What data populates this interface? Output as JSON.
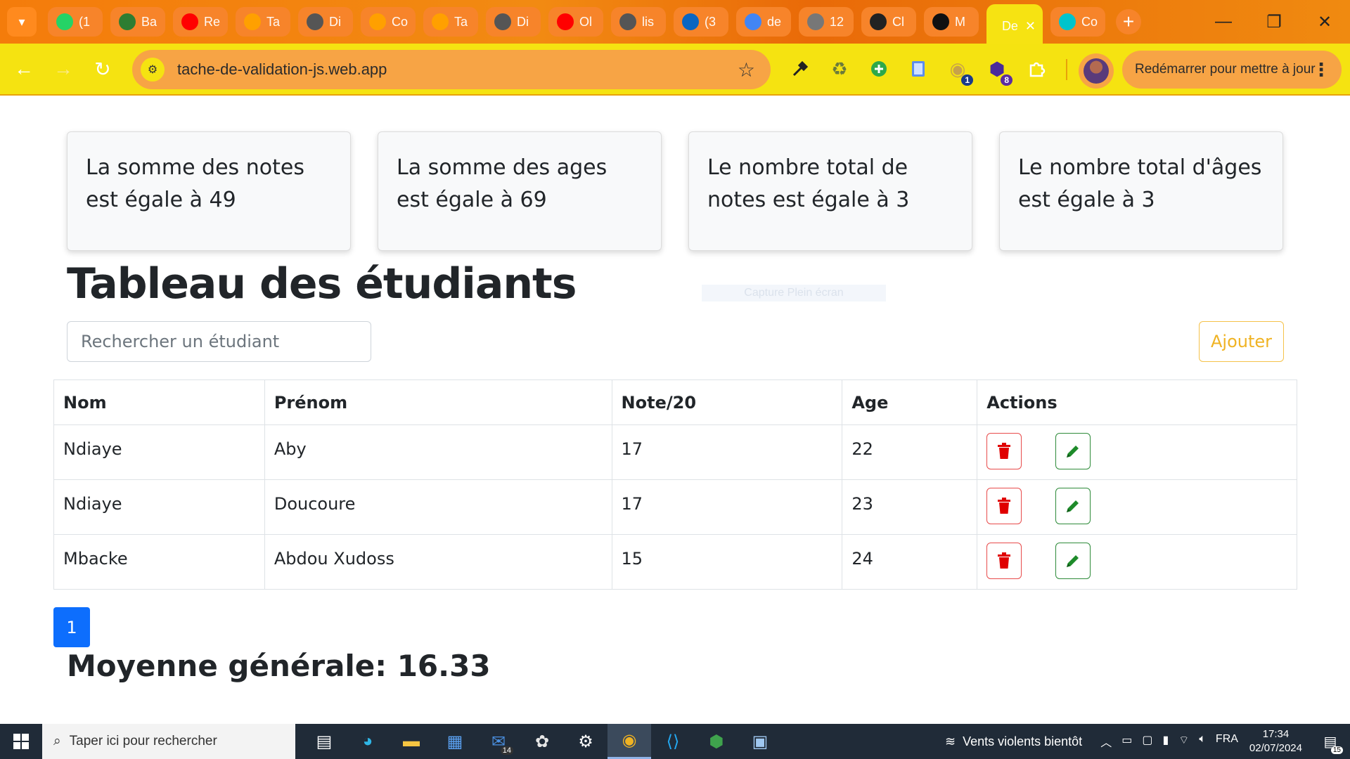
{
  "browser": {
    "tabs": [
      {
        "title": "(1",
        "icon": "whatsapp-icon",
        "color": "#25d366"
      },
      {
        "title": "Ba",
        "icon": "app-icon",
        "color": "#2e7d32"
      },
      {
        "title": "Re",
        "icon": "youtube-icon",
        "color": "#ff0000"
      },
      {
        "title": "Ta",
        "icon": "firebase-icon",
        "color": "#ffa000"
      },
      {
        "title": "Di",
        "icon": "globe-icon",
        "color": "#555555"
      },
      {
        "title": "Co",
        "icon": "firebase-icon",
        "color": "#ffa000"
      },
      {
        "title": "Ta",
        "icon": "firebase-icon",
        "color": "#ffa000"
      },
      {
        "title": "Di",
        "icon": "globe-icon",
        "color": "#555555"
      },
      {
        "title": "Ol",
        "icon": "youtube-icon",
        "color": "#ff0000"
      },
      {
        "title": "lis",
        "icon": "globe-icon",
        "color": "#555555"
      },
      {
        "title": "(3",
        "icon": "linkedin-icon",
        "color": "#0a66c2"
      },
      {
        "title": "de",
        "icon": "docs-icon",
        "color": "#4285f4"
      },
      {
        "title": "12",
        "icon": "globe-icon",
        "color": "#777777"
      },
      {
        "title": "Cl",
        "icon": "chatgpt-icon",
        "color": "#222222"
      },
      {
        "title": "M",
        "icon": "github-icon",
        "color": "#111111"
      },
      {
        "title": "De",
        "icon": "page-icon",
        "color": "#ffffff",
        "active": true
      },
      {
        "title": "Co",
        "icon": "canva-icon",
        "color": "#00c4cc"
      }
    ],
    "url": "tache-de-validation-js.web.app",
    "update_label": "Redémarrer pour mettre à jour",
    "extension_badges": {
      "first": "1",
      "second": "8"
    }
  },
  "page": {
    "cards": [
      "La somme des notes est égale à 49",
      "La somme des ages est égale à 69",
      "Le nombre total de notes est égale à 3",
      "Le nombre total d'âges est égale à 3"
    ],
    "title": "Tableau des étudiants",
    "capture_overlay": "Capture Plein écran",
    "search_placeholder": "Rechercher un étudiant",
    "add_label": "Ajouter",
    "table": {
      "headers": [
        "Nom",
        "Prénom",
        "Note/20",
        "Age",
        "Actions"
      ],
      "rows": [
        {
          "nom": "Ndiaye",
          "prenom": "Aby",
          "note": "17",
          "age": "22"
        },
        {
          "nom": "Ndiaye",
          "prenom": "Doucoure",
          "note": "17",
          "age": "23"
        },
        {
          "nom": "Mbacke",
          "prenom": "Abdou Xudoss",
          "note": "15",
          "age": "24"
        }
      ]
    },
    "pagination": {
      "current": "1"
    },
    "average": "Moyenne générale: 16.33"
  },
  "taskbar": {
    "search_placeholder": "Taper ici pour rechercher",
    "mail_count": "14",
    "weather": "Vents violents bientôt",
    "language": "FRA",
    "time": "17:34",
    "date": "02/07/2024",
    "notifications": "15"
  },
  "colors": {
    "primary": "#0d6efd",
    "warning": "#f0b323",
    "danger": "#e00000",
    "success": "#1e8b2a",
    "chrome_tab": "#f47c0b",
    "chrome_toolbar": "#f5e311"
  }
}
